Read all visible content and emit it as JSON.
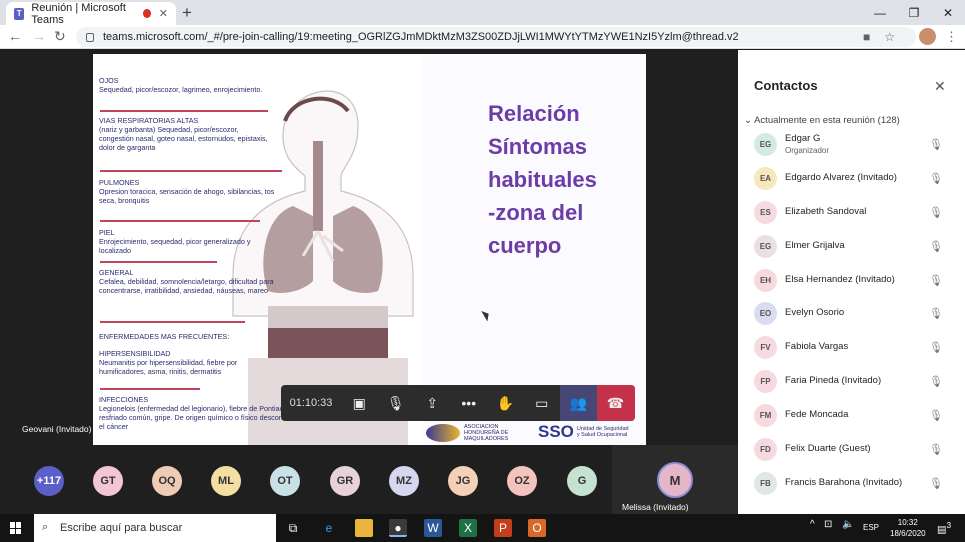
{
  "browser": {
    "tab_title": "Reunión | Microsoft Teams",
    "tab_close": "✕",
    "new_tab": "+",
    "url": "teams.microsoft.com/_#/pre-join-calling/19:meeting_OGRlZGJmMDktMzM3ZS00ZDJjLWI1MWYtYTMzYWE1NzI5Yzlm@thread.v2",
    "window_controls": [
      "—",
      "❐",
      "✕"
    ]
  },
  "slide": {
    "title_lines": [
      "Relación",
      "Síntomas",
      "habituales",
      "-zona del",
      "cuerpo"
    ],
    "sections": [
      {
        "heading": "OJOS",
        "body": "Sequedad, picor/escozor, lagrimeo, enrojecimiento."
      },
      {
        "heading": "VIAS RESPIRATORIAS ALTAS",
        "body": "(nariz y garbanta) Sequedad, picor/escozor, congestión nasal, goteo nasal, estornudos, epistaxis, dolor de garganta"
      },
      {
        "heading": "PULMONES",
        "body": "Opresion toracica, sensación de ahogo, sibilancias, tos seca, bronquitis"
      },
      {
        "heading": "PIEL",
        "body": "Enrojecimiento, sequedad, picor generalizado y localizado"
      },
      {
        "heading": "GENERAL",
        "body": "Cefalea, debilidad, somnolencia/letargo, dificultad para concentrarse, irratibilidad, ansiedad, náuseas, mareo"
      },
      {
        "heading": "ENFERMEDADES MAS FRECUENTES:",
        "body": ""
      },
      {
        "heading": "HIPERSENSIBILIDAD",
        "body": "Neumanitis por hipersensibilidad, fiebre por humificadores, asma, rinitis, dermatitis"
      },
      {
        "heading": "INFECCIONES",
        "body": "Legionelois (enfermedad del legionario), fiebre de Pontiac,tuberculosis, resfriado común, gripe. De origen químico o físico desconocido, incluido el cáncer"
      }
    ],
    "logo1": "ASOCIACION HONDUREÑA DE MAQUILADORES",
    "logo2_mark": "SSO",
    "logo2_text": "Unidad de Seguridad y Salud Ocupacional"
  },
  "call_controls": {
    "timer": "01:10:33",
    "icons": [
      "camera-off-icon",
      "mic-off-icon",
      "share-icon",
      "more-icon",
      "raise-hand-icon",
      "chat-icon",
      "participants-icon",
      "hang-up-icon"
    ],
    "glyphs": [
      "▣",
      "🎙",
      "⇪",
      "•••",
      "✋",
      "▭",
      "👥",
      "☎"
    ]
  },
  "speaker_label": "Geovani (Invitado)",
  "participants_strip": [
    {
      "initials": "+117",
      "color": "#5b5fc7"
    },
    {
      "initials": "GT",
      "color": "#f2c7d3"
    },
    {
      "initials": "OQ",
      "color": "#f0cbb4"
    },
    {
      "initials": "ML",
      "color": "#f3dfa2"
    },
    {
      "initials": "OT",
      "color": "#c9e1e6"
    },
    {
      "initials": "GR",
      "color": "#e6d2d7"
    },
    {
      "initials": "MZ",
      "color": "#d6d6ee"
    },
    {
      "initials": "JG",
      "color": "#f5d0b9"
    },
    {
      "initials": "OZ",
      "color": "#f3c3bd"
    },
    {
      "initials": "G",
      "color": "#c5e2cf"
    }
  ],
  "self_tile": {
    "initials": "M",
    "name": "Melissa (Invitado)"
  },
  "contacts_panel": {
    "title": "Contactos",
    "close": "✕",
    "section": "Actualmente en esta reunión (128)",
    "people": [
      {
        "initials": "EG",
        "name": "Edgar G",
        "role": "Organizador",
        "color": "#d5ebe1"
      },
      {
        "initials": "EA",
        "name": "Edgardo Alvarez (Invitado)",
        "role": "",
        "color": "#f7e7bd"
      },
      {
        "initials": "ES",
        "name": "Elizabeth Sandoval",
        "role": "",
        "color": "#f6dadf"
      },
      {
        "initials": "EG",
        "name": "Elmer Grijalva",
        "role": "",
        "color": "#e9dfe4"
      },
      {
        "initials": "EH",
        "name": "Elsa Hernandez (Invitado)",
        "role": "",
        "color": "#f6dadf"
      },
      {
        "initials": "EO",
        "name": "Evelyn Osorio",
        "role": "",
        "color": "#dbdbf2"
      },
      {
        "initials": "FV",
        "name": "Fabiola Vargas",
        "role": "",
        "color": "#f6dadf"
      },
      {
        "initials": "FP",
        "name": "Faria Pineda (Invitado)",
        "role": "",
        "color": "#f6dadf"
      },
      {
        "initials": "FM",
        "name": "Fede Moncada",
        "role": "",
        "color": "#f6dadf"
      },
      {
        "initials": "FD",
        "name": "Felix Duarte (Guest)",
        "role": "",
        "color": "#f6dadf"
      },
      {
        "initials": "FB",
        "name": "Francis Barahona (Invitado)",
        "role": "",
        "color": "#e0e8e4"
      }
    ]
  },
  "taskbar": {
    "search_placeholder": "Escribe aquí para buscar",
    "lang": "ESP",
    "time": "10:32",
    "date": "18/6/2020",
    "notifications": "3"
  }
}
